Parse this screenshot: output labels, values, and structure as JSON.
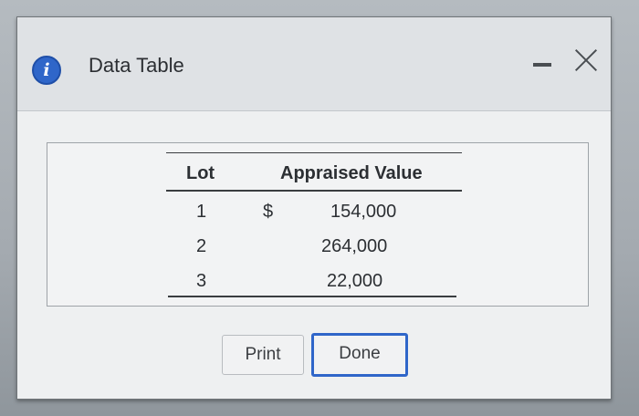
{
  "dialog": {
    "title": "Data Table",
    "info_icon": "i"
  },
  "table": {
    "headers": [
      "Lot",
      "Appraised Value"
    ],
    "currency_symbol": "$",
    "rows": [
      {
        "lot": "1",
        "value": "154,000"
      },
      {
        "lot": "2",
        "value": "264,000"
      },
      {
        "lot": "3",
        "value": "22,000"
      }
    ]
  },
  "buttons": {
    "print": "Print",
    "done": "Done"
  },
  "colors": {
    "accent": "#2f66c9",
    "dialog_bg": "#eef0f1",
    "titlebar_bg": "#dfe2e5"
  }
}
